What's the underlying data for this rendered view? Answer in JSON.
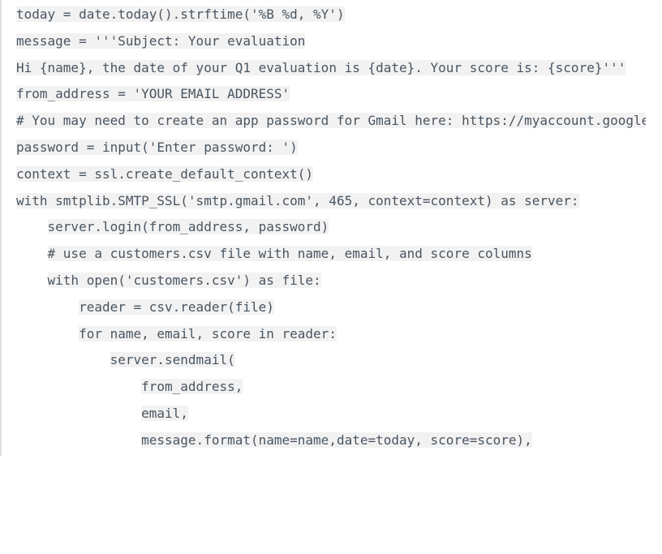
{
  "code": {
    "lines": [
      "today = date.today().strftime('%B %d, %Y')",
      "",
      "message = '''Subject: Your evaluation",
      "",
      "Hi {name}, the date of your Q1 evaluation is {date}. Your score is: {score}'''",
      "from_address = 'YOUR EMAIL ADDRESS'",
      "# You may need to create an app password for Gmail here: https://myaccount.google.com/apppasswords",
      "password = input('Enter password: ')",
      "",
      "context = ssl.create_default_context()",
      "with smtplib.SMTP_SSL('smtp.gmail.com', 465, context=context) as server:",
      "    server.login(from_address, password)",
      "    # use a customers.csv file with name, email, and score columns",
      "    with open('customers.csv') as file:",
      "        reader = csv.reader(file)",
      "        for name, email, score in reader:",
      "            server.sendmail(",
      "                from_address,",
      "                email,",
      "                message.format(name=name,date=today, score=score),"
    ]
  }
}
